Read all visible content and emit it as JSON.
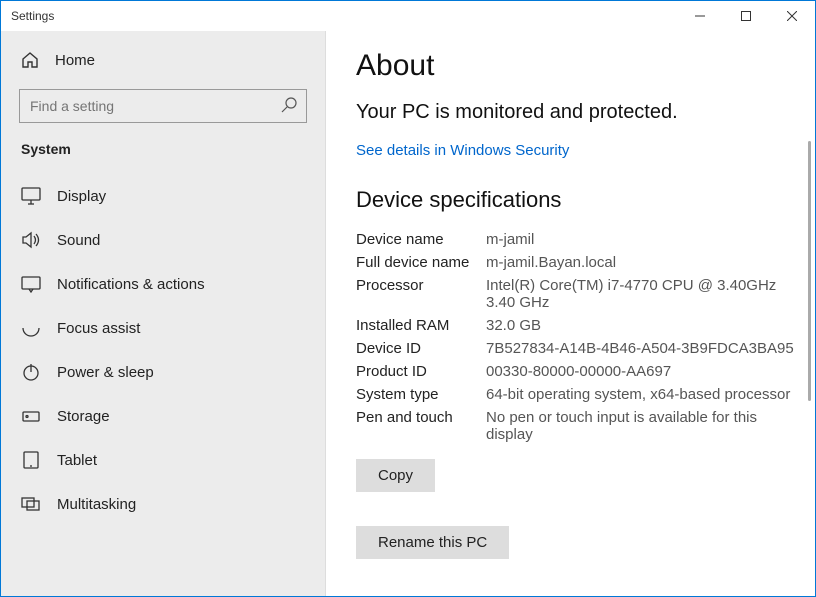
{
  "window": {
    "title": "Settings"
  },
  "sidebar": {
    "home_label": "Home",
    "search_placeholder": "Find a setting",
    "category": "System",
    "items": [
      {
        "label": "Display"
      },
      {
        "label": "Sound"
      },
      {
        "label": "Notifications & actions"
      },
      {
        "label": "Focus assist"
      },
      {
        "label": "Power & sleep"
      },
      {
        "label": "Storage"
      },
      {
        "label": "Tablet"
      },
      {
        "label": "Multitasking"
      }
    ]
  },
  "main": {
    "title": "About",
    "protected_text": "Your PC is monitored and protected.",
    "security_link": "See details in Windows Security",
    "specs_heading": "Device specifications",
    "specs": {
      "device_name": {
        "label": "Device name",
        "value": "m-jamil"
      },
      "full_device_name": {
        "label": "Full device name",
        "value": "m-jamil.Bayan.local"
      },
      "processor": {
        "label": "Processor",
        "value": "Intel(R) Core(TM) i7-4770 CPU @ 3.40GHz   3.40 GHz"
      },
      "ram": {
        "label": "Installed RAM",
        "value": "32.0 GB"
      },
      "device_id": {
        "label": "Device ID",
        "value": "7B527834-A14B-4B46-A504-3B9FDCA3BA95"
      },
      "product_id": {
        "label": "Product ID",
        "value": "00330-80000-00000-AA697"
      },
      "system_type": {
        "label": "System type",
        "value": "64-bit operating system, x64-based processor"
      },
      "pen_touch": {
        "label": "Pen and touch",
        "value": "No pen or touch input is available for this display"
      }
    },
    "copy_button": "Copy",
    "rename_button": "Rename this PC"
  }
}
